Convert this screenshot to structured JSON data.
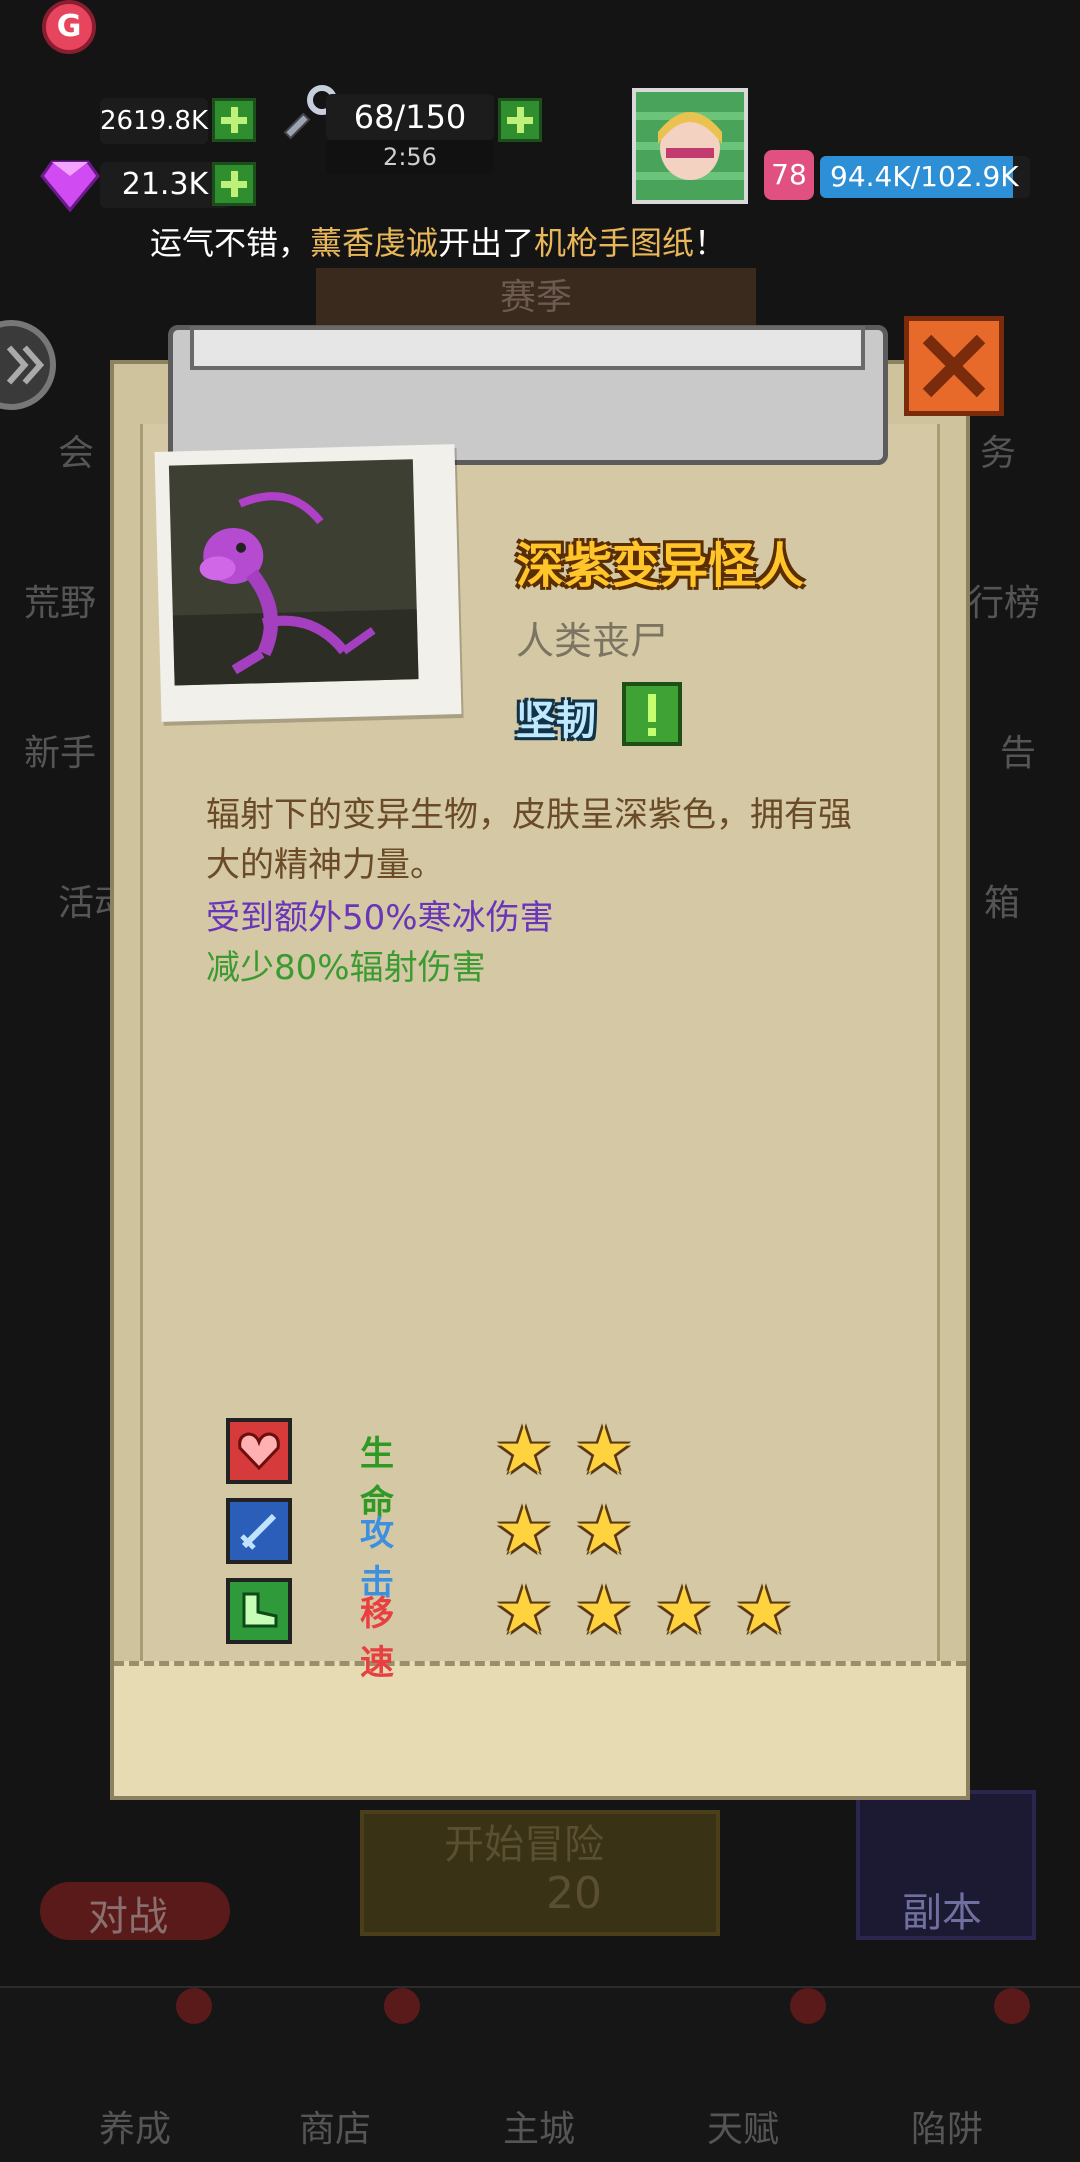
{
  "hud": {
    "gold": "2619.8K",
    "gems": "21.3K",
    "energy": "68/150",
    "energy_timer": "2:56",
    "level": "78",
    "xp": "94.4K/102.9K",
    "xp_fraction": 0.917
  },
  "ticker": {
    "prefix": "运气不错，",
    "player": "薰香虔诚",
    "middle": "开出了",
    "item": "机枪手图纸",
    "suffix": "！"
  },
  "background": {
    "season": "赛季",
    "left_labels": [
      "会",
      "荒野",
      "新手",
      "活动"
    ],
    "right_labels": [
      "务",
      "行榜",
      "告",
      "箱"
    ],
    "battle": "对战",
    "start": "开始冒险",
    "start_cost": "20",
    "dungeon": "副本"
  },
  "monster": {
    "name": "深紫变异怪人",
    "type": "人类丧尸",
    "trait": "坚韧",
    "description": "辐射下的变异生物，皮肤呈深紫色，拥有强大的精神力量。",
    "effect_1": "受到额外50%寒冰伤害",
    "effect_2": "减少80%辐射伤害"
  },
  "stats": [
    {
      "label": "生命",
      "stars": 2,
      "color": "#2e9a23",
      "icon": "heart-icon"
    },
    {
      "label": "攻击",
      "stars": 2,
      "color": "#3f8fe0",
      "icon": "sword-icon"
    },
    {
      "label": "移速",
      "stars": 4,
      "color": "#e84040",
      "icon": "boot-icon"
    }
  ],
  "nav": [
    "养成",
    "商店",
    "主城",
    "天赋",
    "陷阱"
  ],
  "icons": {
    "gold": "gold-coin-icon",
    "gem": "gem-icon",
    "energy": "key-icon",
    "close": "close-icon"
  }
}
